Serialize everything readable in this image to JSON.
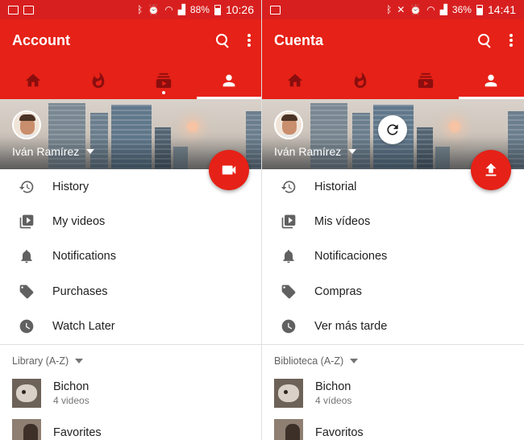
{
  "colors": {
    "statusbar": "#d81f1f",
    "appbar": "#e62117",
    "fab": "#e62117",
    "inactive_tab_icon": "#8b0e0e"
  },
  "panels": [
    {
      "status": {
        "battery": "88%",
        "time": "10:26"
      },
      "appbar": {
        "title": "Account",
        "actions": [
          "search-icon",
          "more-vert-icon"
        ]
      },
      "tabs": [
        "home-icon",
        "trending-icon",
        "subscriptions-icon",
        "account-icon"
      ],
      "active_tab": "account-icon",
      "profile": {
        "name": "Iván Ramírez"
      },
      "fab": {
        "icon": "video-camera-icon"
      },
      "menu": [
        {
          "icon": "history-icon",
          "label": "History"
        },
        {
          "icon": "my-videos-icon",
          "label": "My videos"
        },
        {
          "icon": "notifications-icon",
          "label": "Notifications"
        },
        {
          "icon": "purchases-tag-icon",
          "label": "Purchases"
        },
        {
          "icon": "watch-later-clock-icon",
          "label": "Watch Later"
        }
      ],
      "library": {
        "header": "Library (A-Z)",
        "playlists": [
          {
            "title": "Bichon",
            "count": "4 videos"
          },
          {
            "title": "Favorites",
            "count": ""
          }
        ]
      }
    },
    {
      "status": {
        "battery": "36%",
        "time": "14:41"
      },
      "appbar": {
        "title": "Cuenta",
        "actions": [
          "search-icon",
          "more-vert-icon"
        ]
      },
      "tabs": [
        "home-icon",
        "trending-icon",
        "subscriptions-icon",
        "account-icon"
      ],
      "active_tab": "account-icon",
      "profile": {
        "name": "Iván Ramírez"
      },
      "fab": {
        "icon": "upload-icon"
      },
      "banner_overlay": "refresh-icon",
      "menu": [
        {
          "icon": "history-icon",
          "label": "Historial"
        },
        {
          "icon": "my-videos-icon",
          "label": "Mis vídeos"
        },
        {
          "icon": "notifications-icon",
          "label": "Notificaciones"
        },
        {
          "icon": "purchases-tag-icon",
          "label": "Compras"
        },
        {
          "icon": "watch-later-clock-icon",
          "label": "Ver más tarde"
        }
      ],
      "library": {
        "header": "Biblioteca (A-Z)",
        "playlists": [
          {
            "title": "Bichon",
            "count": "4 vídeos"
          },
          {
            "title": "Favoritos",
            "count": ""
          }
        ]
      }
    }
  ]
}
